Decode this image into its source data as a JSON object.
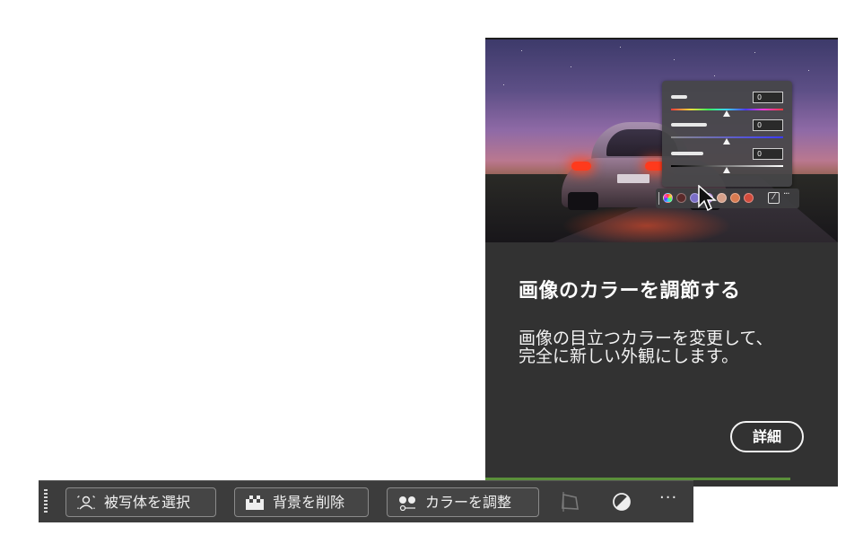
{
  "tooltip": {
    "title": "画像のカラーを調節する",
    "description": "画像の目立つカラーを変更して、完全に新しい外観にします。",
    "details_label": "詳細",
    "preview": {
      "slider_values": [
        "0",
        "0",
        "0"
      ],
      "swatch_colors": [
        "#5b2a2a",
        "#7b6fc8",
        "#a06fd2",
        "#d6a08a",
        "#d87a50",
        "#d14b3c"
      ]
    }
  },
  "taskbar": {
    "select_subject_label": "被写体を選択",
    "remove_background_label": "背景を削除",
    "adjust_color_label": "カラーを調整",
    "more_label": "···"
  },
  "colors": {
    "card_bg": "#323232",
    "taskbar_bg": "#3c3c3c",
    "accent_green": "#5a8f3a"
  }
}
